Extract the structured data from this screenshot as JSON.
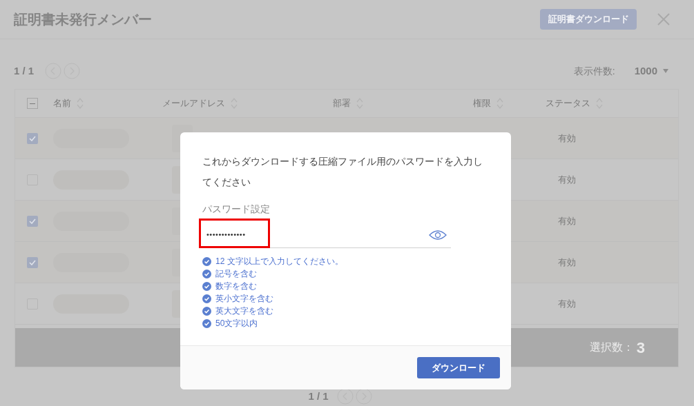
{
  "header": {
    "title": "証明書未発行メンバー",
    "download_button": "証明書ダウンロード"
  },
  "pagination": {
    "page": "1 / 1",
    "per_page_label": "表示件数:",
    "per_page": "1000"
  },
  "table": {
    "select_all_indeterminate": true,
    "columns": [
      "名前",
      "メールアドレス",
      "部署",
      "権限",
      "ステータス"
    ],
    "rows": [
      {
        "checked": true,
        "status": "有効"
      },
      {
        "checked": false,
        "status": "有効"
      },
      {
        "checked": true,
        "status": "有効"
      },
      {
        "checked": true,
        "status": "有効"
      },
      {
        "checked": false,
        "status": "有効"
      }
    ],
    "footer": {
      "label": "選択数：",
      "count": "3"
    }
  },
  "bottom_pagination": {
    "page": "1 / 1"
  },
  "dialog": {
    "message": "これからダウンロードする圧縮ファイル用のパスワードを入力してください",
    "field_label": "パスワード設定",
    "password": "•••••••••••••",
    "rules": [
      {
        "text": "12 文字以上で入力してください。",
        "met": true
      },
      {
        "text": "記号を含む",
        "met": true
      },
      {
        "text": "数字を含む",
        "met": true
      },
      {
        "text": "英小文字を含む",
        "met": true
      },
      {
        "text": "英大文字を含む",
        "met": true
      },
      {
        "text": "50文字以内",
        "met": true
      }
    ],
    "button": "ダウンロード"
  }
}
